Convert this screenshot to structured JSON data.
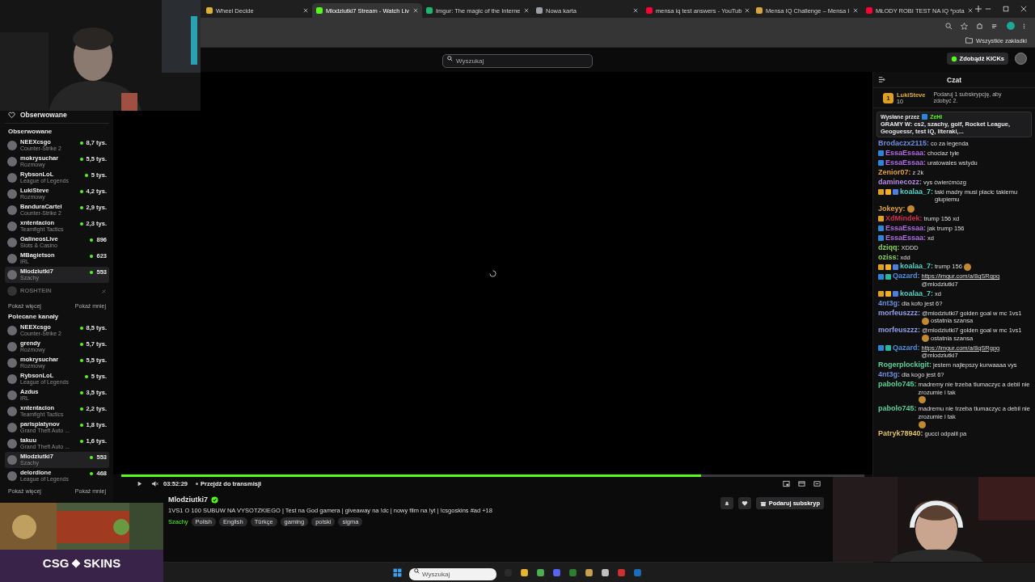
{
  "browser": {
    "tabs": [
      {
        "title": "Wheel Decide",
        "selected": false
      },
      {
        "title": "Mlodziutki7 Stream - Watch Liv",
        "selected": true
      },
      {
        "title": "Imgur: The magic of the Interne",
        "selected": false
      },
      {
        "title": "Nowa karta",
        "selected": false
      },
      {
        "title": "mensa iq test answers - YouTub",
        "selected": false
      },
      {
        "title": "Mensa IQ Challenge – Mensa I",
        "selected": false
      },
      {
        "title": "MŁODY ROBI TEST NA IQ *pota",
        "selected": false
      }
    ],
    "bookmarks_label": "Wszystkie zakładki"
  },
  "header": {
    "search_placeholder": "Wyszukaj",
    "kicks_button": "Zdobądź KICKs"
  },
  "sidebar": {
    "following_title": "Obserwowane",
    "following_section": "Obserwowane",
    "following": [
      {
        "name": "NEEXcsgo",
        "category": "Counter-Strike 2",
        "viewers": "8,7 tys.",
        "live": true,
        "selected": false
      },
      {
        "name": "mokrysuchar",
        "category": "Rozmowy",
        "viewers": "5,5 tys.",
        "live": true,
        "selected": false
      },
      {
        "name": "RybsonLoL",
        "category": "League of Legends",
        "viewers": "5 tys.",
        "live": true,
        "selected": false
      },
      {
        "name": "LukiSteve",
        "category": "Rozmowy",
        "viewers": "4,2 tys.",
        "live": true,
        "selected": false
      },
      {
        "name": "BanduraCartel",
        "category": "Counter-Strike 2",
        "viewers": "2,9 tys.",
        "live": true,
        "selected": false
      },
      {
        "name": "xntentacion",
        "category": "Teamfight Tactics",
        "viewers": "2,3 tys.",
        "live": true,
        "selected": false
      },
      {
        "name": "GalineosLive",
        "category": "Slots & Casino",
        "viewers": "896",
        "live": true,
        "selected": false
      },
      {
        "name": "MBagietson",
        "category": "IRL",
        "viewers": "623",
        "live": true,
        "selected": false
      },
      {
        "name": "Mlodziutki7",
        "category": "Szachy",
        "viewers": "553",
        "live": true,
        "selected": true
      },
      {
        "name": "ROSHTEIN",
        "live": false,
        "selected": false
      }
    ],
    "show_more": "Pokaż więcej",
    "show_less": "Pokaż mniej",
    "recommended_title": "Polecane kanały",
    "recommended": [
      {
        "name": "NEEXcsgo",
        "category": "Counter-Strike 2",
        "viewers": "8,5 tys.",
        "live": true,
        "selected": false
      },
      {
        "name": "grendy",
        "category": "Rozmowy",
        "viewers": "5,7 tys.",
        "live": true,
        "selected": false
      },
      {
        "name": "mokrysuchar",
        "category": "Rozmowy",
        "viewers": "5,5 tys.",
        "live": true,
        "selected": false
      },
      {
        "name": "RybsonLoL",
        "category": "League of Legends",
        "viewers": "5 tys.",
        "live": true,
        "selected": false
      },
      {
        "name": "Azdus",
        "category": "IRL",
        "viewers": "3,5 tys.",
        "live": true,
        "selected": false
      },
      {
        "name": "xntentacion",
        "category": "Teamfight Tactics",
        "viewers": "2,2 tys.",
        "live": true,
        "selected": false
      },
      {
        "name": "parisplatynov",
        "category": "Grand Theft Auto ...",
        "viewers": "1,8 tys.",
        "live": true,
        "selected": false
      },
      {
        "name": "takuu",
        "category": "Grand Theft Auto ...",
        "viewers": "1,6 tys.",
        "live": true,
        "selected": false
      },
      {
        "name": "Mlodziutki7",
        "category": "Szachy",
        "viewers": "553",
        "live": true,
        "selected": true
      },
      {
        "name": "delordione",
        "category": "League of Legends",
        "viewers": "468",
        "live": true,
        "selected": false
      }
    ],
    "show_more_2": "Pokaż więcej",
    "show_less_2": "Pokaż mniej"
  },
  "player": {
    "level": 0.78,
    "time": "03:52:29",
    "go_live": "Przejdź do transmisji"
  },
  "stream": {
    "channel": "Mlodziutki7",
    "verified": true,
    "title": "1VS1 O 100 SUBUW NA VYSOTZKIEGO | Test na God gamera | giveaway na !dc | nowy film na  !yt  | !csgoskins  #ad +18",
    "category": "Szachy",
    "tags": [
      "Polish",
      "English",
      "Türkçe",
      "gaming",
      "polski",
      "sigma"
    ],
    "gift_button": "Podaruj subskryp"
  },
  "ad": {
    "brand_left": "CSG",
    "brand_right": "SKINS"
  },
  "chat": {
    "title": "Czat",
    "gifter": {
      "rank": "1",
      "name": "LukiSteve",
      "count": "10",
      "prompt": "Podaruj 1 subskrypcję, aby zdobyć 2."
    },
    "pinned": {
      "label": "Wysłane przez",
      "user": "ZeHi",
      "text": "GRAMY W: cs2, szachy, golf, Rocket League, Geoguessr, test IQ, literaki,..."
    },
    "messages": [
      {
        "user": "Brodaczx2115:",
        "color": "#6f8fe0",
        "parts": [
          {
            "kind": "text",
            "text": "co za legenda"
          }
        ]
      },
      {
        "user": "EssaEssaa:",
        "color": "#b06be0",
        "badges": [
          {
            "color": "#2e86d9"
          }
        ],
        "parts": [
          {
            "kind": "text",
            "text": "chociaz tyle"
          }
        ]
      },
      {
        "user": "EssaEssaa:",
        "color": "#b06be0",
        "badges": [
          {
            "color": "#2e86d9"
          }
        ],
        "parts": [
          {
            "kind": "text",
            "text": "uratowales wstydu"
          }
        ]
      },
      {
        "user": "Zenior07:",
        "color": "#e0a040",
        "parts": [
          {
            "kind": "text",
            "text": "z 2k"
          }
        ]
      },
      {
        "user": "daminecozz:",
        "color": "#b48ae6",
        "parts": [
          {
            "kind": "text",
            "text": "vys ćwierćmózg"
          }
        ]
      },
      {
        "user": "koalaa_7:",
        "color": "#4fd1c5",
        "badges": [
          {
            "color": "#e0a020"
          },
          {
            "color": "#f0b020"
          },
          {
            "color": "#4a7fe0"
          }
        ],
        "parts": [
          {
            "kind": "text",
            "text": "taki madry musi placic takiemu glupiemu"
          }
        ]
      },
      {
        "user": "Jokeyy:",
        "color": "#e0a040",
        "parts": [
          {
            "kind": "emote"
          }
        ]
      },
      {
        "user": "XdMindek:",
        "color": "#d0304a",
        "badges": [
          {
            "color": "#e0a020"
          }
        ],
        "parts": [
          {
            "kind": "text",
            "text": "trump 156 xd"
          }
        ]
      },
      {
        "user": "EssaEssaa:",
        "color": "#b06be0",
        "badges": [
          {
            "color": "#2e86d9"
          }
        ],
        "parts": [
          {
            "kind": "text",
            "text": "jak trump 156"
          }
        ]
      },
      {
        "user": "EssaEssaa:",
        "color": "#b06be0",
        "badges": [
          {
            "color": "#2e86d9"
          }
        ],
        "parts": [
          {
            "kind": "text",
            "text": "xd"
          }
        ]
      },
      {
        "user": "dziqq:",
        "color": "#8bd35a",
        "parts": [
          {
            "kind": "text",
            "text": "XDDD"
          }
        ]
      },
      {
        "user": "oziss:",
        "color": "#8bd35a",
        "parts": [
          {
            "kind": "text",
            "text": "xdd"
          }
        ]
      },
      {
        "user": "koalaa_7:",
        "color": "#4fd1c5",
        "badges": [
          {
            "color": "#e0a020"
          },
          {
            "color": "#f0b020"
          },
          {
            "color": "#4a7fe0"
          }
        ],
        "parts": [
          {
            "kind": "text",
            "text": "trump 156"
          },
          {
            "kind": "emote"
          }
        ]
      },
      {
        "user": "Qazard:",
        "color": "#4f8fe0",
        "badges": [
          {
            "color": "#2e86d9"
          },
          {
            "color": "#2bb5a0"
          }
        ],
        "parts": [
          {
            "kind": "link",
            "text": "https://imgur.com/a/8qSRgpg"
          },
          {
            "kind": "text",
            "text": "@mlodziutki7"
          }
        ]
      },
      {
        "user": "koalaa_7:",
        "color": "#4fd1c5",
        "badges": [
          {
            "color": "#e0a020"
          },
          {
            "color": "#f0b020"
          },
          {
            "color": "#4a7fe0"
          }
        ],
        "parts": [
          {
            "kind": "text",
            "text": "xd"
          }
        ]
      },
      {
        "user": "4nt3g:",
        "color": "#6f8fe0",
        "parts": [
          {
            "kind": "text",
            "text": "dla kofo jest 6?"
          }
        ]
      },
      {
        "user": "morfeuszzz:",
        "color": "#8fa0e8",
        "parts": [
          {
            "kind": "text",
            "text": "@mlodziutki7 golden goal w mc 1vs1"
          },
          {
            "kind": "emote"
          },
          {
            "kind": "text",
            "text": "ostatnia szansa"
          }
        ]
      },
      {
        "user": "morfeuszzz:",
        "color": "#8fa0e8",
        "parts": [
          {
            "kind": "text",
            "text": "@mlodziutki7 golden goal w mc 1vs1"
          },
          {
            "kind": "emote"
          },
          {
            "kind": "text",
            "text": "ostatnia szansa"
          }
        ]
      },
      {
        "user": "Qazard:",
        "color": "#4f8fe0",
        "badges": [
          {
            "color": "#2e86d9"
          },
          {
            "color": "#2bb5a0"
          }
        ],
        "parts": [
          {
            "kind": "link",
            "text": "https://imgur.com/a/8qSRgpg"
          },
          {
            "kind": "text",
            "text": "@mlodziutki7"
          }
        ]
      },
      {
        "user": "Rogerplockigit:",
        "color": "#5ad19a",
        "parts": [
          {
            "kind": "text",
            "text": "jestem najlepszy kurwaaaa vys"
          }
        ]
      },
      {
        "user": "4nt3g:",
        "color": "#6f8fe0",
        "parts": [
          {
            "kind": "text",
            "text": "dla kogo jest 6?"
          }
        ]
      },
      {
        "user": "pabolo745:",
        "color": "#5ad19a",
        "parts": [
          {
            "kind": "text",
            "text": "madremy nie trzeba tlumaczyc a debil nie zrozumie i tak"
          },
          {
            "kind": "emote"
          }
        ]
      },
      {
        "user": "pabolo745:",
        "color": "#5ad19a",
        "parts": [
          {
            "kind": "text",
            "text": "madremu nie trzeba tlumaczyc a debil nie zrozumie i tak"
          },
          {
            "kind": "emote"
          }
        ]
      },
      {
        "user": "Patryk78940:",
        "color": "#e0c060",
        "parts": [
          {
            "kind": "text",
            "text": "gucci odpalil pa"
          }
        ]
      }
    ]
  },
  "taskbar": {
    "search_placeholder": "Wyszukaj"
  }
}
